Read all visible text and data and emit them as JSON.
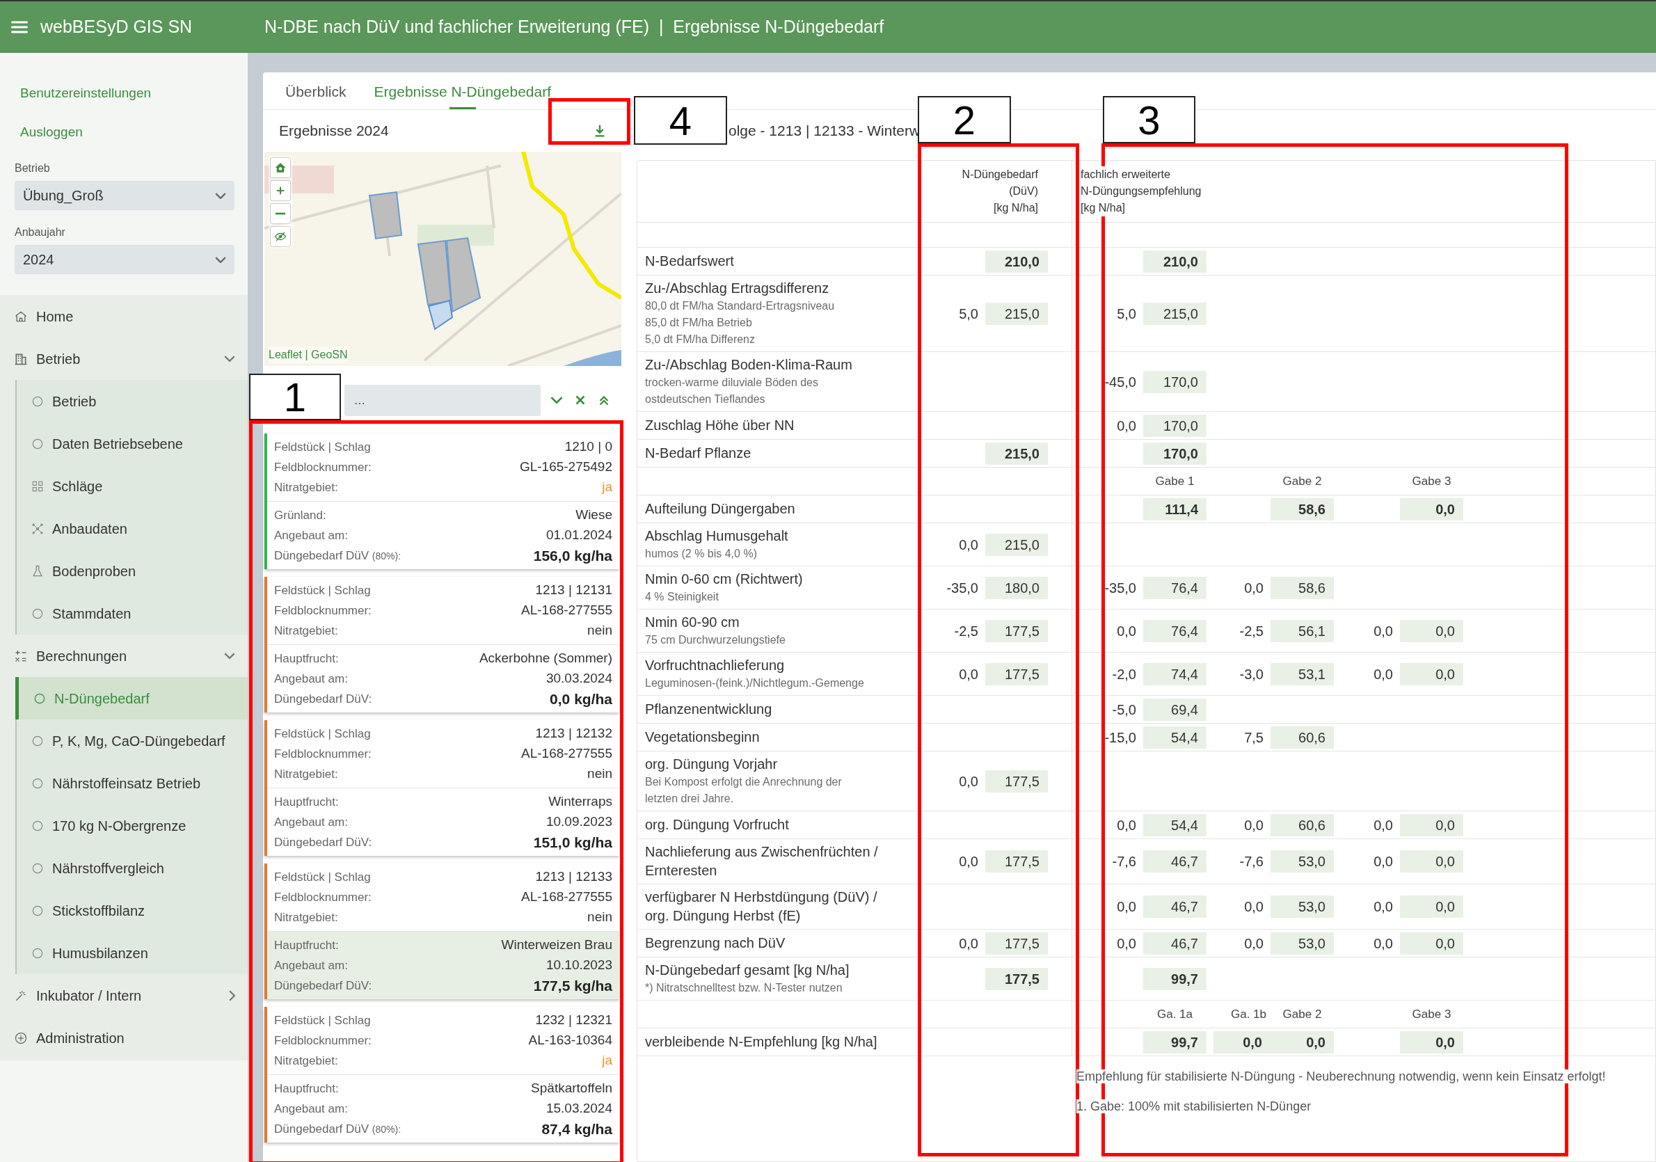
{
  "header": {
    "app_title": "webBESyD GIS SN",
    "page_title": "N-DBE nach DüV und fachlicher Erweiterung (FE)  |  Ergebnisse N-Düngebedarf"
  },
  "sidebar": {
    "links": [
      "Benutzereinstellungen",
      "Ausloggen"
    ],
    "selects": [
      {
        "label": "Betrieb",
        "value": "Übung_Groß"
      },
      {
        "label": "Anbaujahr",
        "value": "2024"
      }
    ],
    "nav": [
      {
        "label": "Home"
      },
      {
        "label": "Betrieb",
        "expanded": true,
        "children": [
          {
            "label": "Betrieb",
            "selected": false
          },
          {
            "label": "Daten Betriebsebene",
            "selected": false
          },
          {
            "label": "Schläge",
            "selected": false
          },
          {
            "label": "Anbaudaten",
            "selected": false
          },
          {
            "label": "Bodenproben",
            "selected": false
          },
          {
            "label": "Stammdaten",
            "selected": false
          }
        ]
      },
      {
        "label": "Berechnungen",
        "expanded": true,
        "children": [
          {
            "label": "N-Düngebedarf",
            "selected": true
          },
          {
            "label": "P, K, Mg, CaO-Düngebedarf",
            "selected": false
          },
          {
            "label": "Nährstoffeinsatz Betrieb",
            "selected": false
          },
          {
            "label": "170 kg N-Obergrenze",
            "selected": false
          },
          {
            "label": "Nährstoffvergleich",
            "selected": false
          },
          {
            "label": "Stickstoffbilanz",
            "selected": false
          },
          {
            "label": "Humusbilanzen",
            "selected": false
          }
        ]
      },
      {
        "label": "Inkubator / Intern",
        "expanded": false
      },
      {
        "label": "Administration"
      }
    ]
  },
  "tabs": [
    {
      "label": "Überblick",
      "selected": false
    },
    {
      "label": "Ergebnisse N-Düngebedarf",
      "selected": true
    }
  ],
  "results": {
    "title": "Ergebnisse 2024",
    "map": {
      "kind": "picture",
      "attribution": "Leaflet | GeoSN"
    },
    "filter": {
      "placeholder": "..."
    },
    "cards": [
      {
        "color": "#2fb84a",
        "selected": false,
        "nitrate_area": true,
        "field": [
          {
            "label": "Feldstück | Schlag",
            "value": "1210 | 0"
          },
          {
            "label": "Feldblocknummer:",
            "value": "GL-165-275492"
          },
          {
            "label": "Nitratgebiet:",
            "value": "ja"
          }
        ],
        "crop": [
          {
            "label": "Grünland:",
            "value": "Wiese"
          },
          {
            "label": "Angebaut am:",
            "value": "01.01.2024"
          },
          {
            "label": "Düngebedarf DüV",
            "note": "(80%):",
            "value": "156,0 kg/ha"
          }
        ]
      },
      {
        "color": "#e07a35",
        "selected": false,
        "nitrate_area": false,
        "field": [
          {
            "label": "Feldstück | Schlag",
            "value": "1213 | 12131"
          },
          {
            "label": "Feldblocknummer:",
            "value": "AL-168-277555"
          },
          {
            "label": "Nitratgebiet:",
            "value": "nein"
          }
        ],
        "crop": [
          {
            "label": "Hauptfrucht:",
            "value": "Ackerbohne (Sommer)"
          },
          {
            "label": "Angebaut am:",
            "value": "30.03.2024"
          },
          {
            "label": "Düngebedarf DüV:",
            "value": "0,0 kg/ha"
          }
        ]
      },
      {
        "color": "#e07a35",
        "selected": false,
        "nitrate_area": false,
        "field": [
          {
            "label": "Feldstück | Schlag",
            "value": "1213 | 12132"
          },
          {
            "label": "Feldblocknummer:",
            "value": "AL-168-277555"
          },
          {
            "label": "Nitratgebiet:",
            "value": "nein"
          }
        ],
        "crop": [
          {
            "label": "Hauptfrucht:",
            "value": "Winterraps"
          },
          {
            "label": "Angebaut am:",
            "value": "10.09.2023"
          },
          {
            "label": "Düngebedarf DüV:",
            "value": "151,0 kg/ha"
          }
        ]
      },
      {
        "color": "#e07a35",
        "selected": true,
        "nitrate_area": false,
        "field": [
          {
            "label": "Feldstück | Schlag",
            "value": "1213 | 12133"
          },
          {
            "label": "Feldblocknummer:",
            "value": "AL-168-277555"
          },
          {
            "label": "Nitratgebiet:",
            "value": "nein"
          }
        ],
        "crop": [
          {
            "label": "Hauptfrucht:",
            "value": "Winterweizen Brau"
          },
          {
            "label": "Angebaut am:",
            "value": "10.10.2023"
          },
          {
            "label": "Düngebedarf DüV:",
            "value": "177,5 kg/ha"
          }
        ]
      },
      {
        "color": "#e07a35",
        "selected": false,
        "nitrate_area": true,
        "field": [
          {
            "label": "Feldstück | Schlag",
            "value": "1232 | 12321"
          },
          {
            "label": "Feldblocknummer:",
            "value": "AL-163-10364"
          },
          {
            "label": "Nitratgebiet:",
            "value": "ja"
          }
        ],
        "crop": [
          {
            "label": "Hauptfrucht:",
            "value": "Spätkartoffeln"
          },
          {
            "label": "Angebaut am:",
            "value": "15.03.2024"
          },
          {
            "label": "Düngebedarf DüV",
            "note": "(80%):",
            "value": "87,4 kg/ha"
          }
        ]
      }
    ]
  },
  "table": {
    "caption": "olge - 1213 | 12133 - Winterw",
    "duv_header": "N-Düngebedarf\n(DüV)\n[kg N/ha]",
    "fe_header": "fachlich erweiterte\nN-Düngungsempfehlung\n[kg N/ha]",
    "rows": [
      {
        "kind": "total",
        "label": "N-Bedarfswert",
        "duv": {
          "value": "210,0"
        },
        "fe": [
          {
            "value": "210,0"
          }
        ]
      },
      {
        "kind": "step",
        "label": "Zu-/Abschlag Ertragsdifferenz",
        "note": "80,0 dt FM/ha Standard-Ertragsniveau\n85,0 dt FM/ha Betrieb\n5,0 dt FM/ha Differenz",
        "duv": {
          "delta": "5,0",
          "value": "215,0"
        },
        "fe": [
          {
            "delta": "5,0",
            "value": "215,0"
          }
        ]
      },
      {
        "kind": "step",
        "label": "Zu-/Abschlag Boden-Klima-Raum",
        "note": "trocken-warme diluviale Böden des\nostdeutschen Tieflandes",
        "fe": [
          {
            "delta": "-45,0",
            "value": "170,0"
          }
        ]
      },
      {
        "kind": "step",
        "label": "Zuschlag Höhe über NN",
        "fe": [
          {
            "delta": "0,0",
            "value": "170,0"
          }
        ]
      },
      {
        "kind": "total",
        "label": "N-Bedarf Pflanze",
        "duv": {
          "value": "215,0"
        },
        "fe": [
          {
            "value": "170,0"
          }
        ]
      },
      {
        "kind": "gabe_header",
        "fe": [
          {
            "value": "Gabe 1"
          },
          {
            "value": "Gabe 2"
          },
          {
            "value": "Gabe 3"
          }
        ]
      },
      {
        "kind": "total",
        "label": "Aufteilung Düngergaben",
        "fe": [
          {
            "value": "111,4"
          },
          {
            "value": "58,6"
          },
          {
            "value": "0,0"
          }
        ]
      },
      {
        "kind": "step",
        "label": "Abschlag Humusgehalt",
        "note": "humos (2 % bis 4,0 %)",
        "duv": {
          "delta": "0,0",
          "value": "215,0"
        }
      },
      {
        "kind": "step",
        "label": "Nmin 0-60 cm (Richtwert)",
        "note": "4 % Steinigkeit",
        "duv": {
          "delta": "-35,0",
          "value": "180,0"
        },
        "fe": [
          {
            "delta": "-35,0",
            "value": "76,4"
          },
          {
            "delta": "0,0",
            "value": "58,6"
          }
        ]
      },
      {
        "kind": "step",
        "label": "Nmin 60-90 cm",
        "note": "75 cm Durchwurzelungstiefe",
        "duv": {
          "delta": "-2,5",
          "value": "177,5"
        },
        "fe": [
          {
            "delta": "0,0",
            "value": "76,4"
          },
          {
            "delta": "-2,5",
            "value": "56,1"
          },
          {
            "delta": "0,0",
            "value": "0,0"
          }
        ]
      },
      {
        "kind": "step",
        "label": "Vorfruchtnachlieferung",
        "note": "Leguminosen-(feink.)/Nichtlegum.-Gemenge",
        "duv": {
          "delta": "0,0",
          "value": "177,5"
        },
        "fe": [
          {
            "delta": "-2,0",
            "value": "74,4"
          },
          {
            "delta": "-3,0",
            "value": "53,1"
          },
          {
            "delta": "0,0",
            "value": "0,0"
          }
        ]
      },
      {
        "kind": "step",
        "label": "Pflanzenentwicklung",
        "fe": [
          {
            "delta": "-5,0",
            "value": "69,4"
          }
        ]
      },
      {
        "kind": "step",
        "label": "Vegetationsbeginn",
        "fe": [
          {
            "delta": "-15,0",
            "value": "54,4"
          },
          {
            "delta": "7,5",
            "value": "60,6"
          }
        ]
      },
      {
        "kind": "step",
        "label": "org. Düngung Vorjahr",
        "note": "Bei Kompost erfolgt die Anrechnung der\nletzten drei Jahre.",
        "duv": {
          "delta": "0,0",
          "value": "177,5"
        }
      },
      {
        "kind": "step",
        "label": "org. Düngung Vorfrucht",
        "fe": [
          {
            "delta": "0,0",
            "value": "54,4"
          },
          {
            "delta": "0,0",
            "value": "60,6"
          },
          {
            "delta": "0,0",
            "value": "0,0"
          }
        ]
      },
      {
        "kind": "step",
        "label": "Nachlieferung aus Zwischenfrüchten /\nErnteresten",
        "duv": {
          "delta": "0,0",
          "value": "177,5"
        },
        "fe": [
          {
            "delta": "-7,6",
            "value": "46,7"
          },
          {
            "delta": "-7,6",
            "value": "53,0"
          },
          {
            "delta": "0,0",
            "value": "0,0"
          }
        ]
      },
      {
        "kind": "step",
        "label": "verfügbarer N Herbstdüngung (DüV) /\norg. Düngung Herbst (fE)",
        "fe": [
          {
            "delta": "0,0",
            "value": "46,7"
          },
          {
            "delta": "0,0",
            "value": "53,0"
          },
          {
            "delta": "0,0",
            "value": "0,0"
          }
        ]
      },
      {
        "kind": "step",
        "label": "Begrenzung nach DüV",
        "duv": {
          "delta": "0,0",
          "value": "177,5"
        },
        "fe": [
          {
            "delta": "0,0",
            "value": "46,7"
          },
          {
            "delta": "0,0",
            "value": "53,0"
          },
          {
            "delta": "0,0",
            "value": "0,0"
          }
        ]
      },
      {
        "kind": "total",
        "label": "N-Düngebedarf gesamt [kg N/ha]",
        "note": "*) Nitratschnelltest bzw. N-Tester nutzen",
        "duv": {
          "value": "177,5"
        },
        "fe": [
          {
            "value": "99,7"
          }
        ]
      },
      {
        "kind": "gabe_header",
        "fe": [
          {
            "value": "Ga. 1a"
          },
          {
            "delta": "Ga. 1b",
            "value": "Gabe 2"
          },
          {
            "value": "Gabe 3"
          }
        ]
      },
      {
        "kind": "total",
        "label": "verbleibende N-Empfehlung [kg N/ha]",
        "fe": [
          {
            "value": "99,7"
          },
          {
            "delta": "0,0",
            "value": "0,0"
          },
          {
            "value": "0,0"
          }
        ]
      }
    ],
    "footnotes": [
      "Empfehlung für stabilisierte N-Düngung - Neuberechnung notwendig, wenn kein Einsatz erfolgt!",
      "1. Gabe: 100% mit stabilisierten N-Dünger"
    ]
  },
  "annotations": [
    {
      "label": "1"
    },
    {
      "label": "4"
    },
    {
      "label": "2"
    },
    {
      "label": "3"
    }
  ]
}
